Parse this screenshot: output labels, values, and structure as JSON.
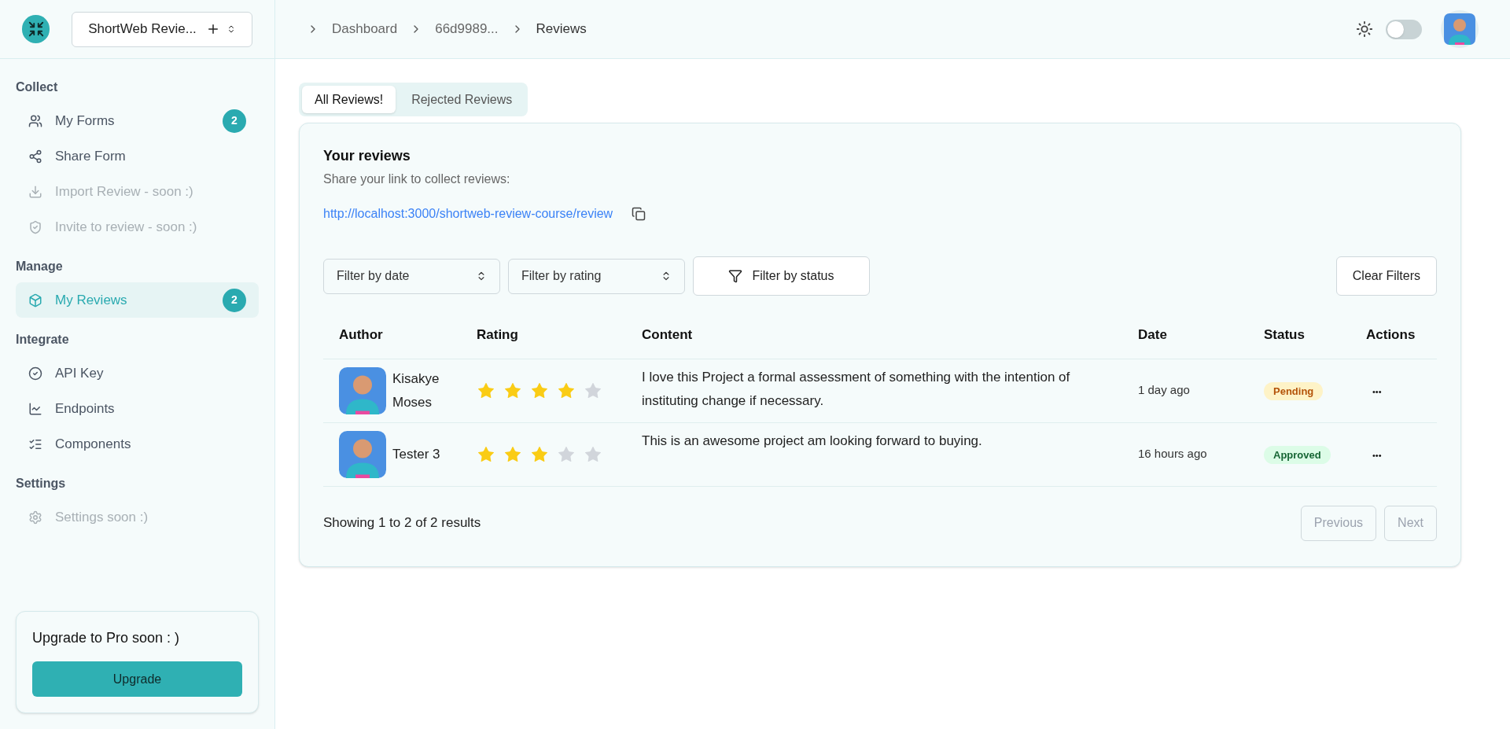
{
  "header": {
    "project": "ShortWeb Revie...",
    "breadcrumbs": [
      "Dashboard",
      "66d9989...",
      "Reviews"
    ],
    "dark_mode": {
      "on": false
    }
  },
  "sidebar": {
    "sections": [
      {
        "title": "Collect",
        "items": [
          {
            "label": "My Forms",
            "kind": "users",
            "badge": "2",
            "disabled": false,
            "selected": false
          },
          {
            "label": "Share Form",
            "kind": "share",
            "disabled": false,
            "selected": false
          },
          {
            "label": "Import Review - soon :)",
            "kind": "download",
            "disabled": true,
            "selected": false
          },
          {
            "label": "Invite to review - soon :)",
            "kind": "shield",
            "disabled": true,
            "selected": false
          }
        ]
      },
      {
        "title": "Manage",
        "items": [
          {
            "label": "My Reviews",
            "kind": "box",
            "badge": "2",
            "disabled": false,
            "selected": true
          }
        ]
      },
      {
        "title": "Integrate",
        "items": [
          {
            "label": "API Key",
            "kind": "check",
            "disabled": false,
            "selected": false
          },
          {
            "label": "Endpoints",
            "kind": "chart",
            "disabled": false,
            "selected": false
          },
          {
            "label": "Components",
            "kind": "list",
            "disabled": false,
            "selected": false
          }
        ]
      },
      {
        "title": "Settings",
        "items": [
          {
            "label": "Settings soon :)",
            "kind": "gear",
            "disabled": true,
            "selected": false
          }
        ]
      }
    ],
    "upgrade": {
      "title": "Upgrade to Pro soon : )",
      "button": "Upgrade"
    }
  },
  "tabs": [
    {
      "label": "All Reviews!",
      "selected": true
    },
    {
      "label": "Rejected Reviews",
      "selected": false
    }
  ],
  "card": {
    "title": "Your reviews",
    "subtitle": "Share your link to collect reviews:",
    "link": "http://localhost:3000/shortweb-review-course/review",
    "filters": [
      {
        "kind": "select",
        "label": "Filter by date"
      },
      {
        "kind": "select",
        "label": "Filter by rating"
      },
      {
        "kind": "button",
        "label": "Filter by status"
      }
    ],
    "clear": "Clear Filters",
    "table": {
      "columns": [
        "Author",
        "Rating",
        "Content",
        "Date",
        "Status",
        "Actions"
      ],
      "rows": [
        {
          "author": "Kisakye Moses",
          "stars": 4,
          "content": "I love this Project a formal assessment of something with the intention of instituting change if necessary.",
          "date": "1 day ago",
          "status": {
            "label": "Pending",
            "kind": "pending"
          },
          "actions": "•••"
        },
        {
          "author": "Tester 3",
          "stars": 3,
          "content": "This is an awesome project am looking forward to buying.",
          "date": "16 hours ago",
          "status": {
            "label": "Approved",
            "kind": "approved"
          },
          "actions": "•••"
        }
      ]
    },
    "summary": "Showing 1 to 2 of 2 results",
    "pager": [
      {
        "label": "Previous",
        "disabled": true
      },
      {
        "label": "Next",
        "disabled": true
      }
    ]
  }
}
